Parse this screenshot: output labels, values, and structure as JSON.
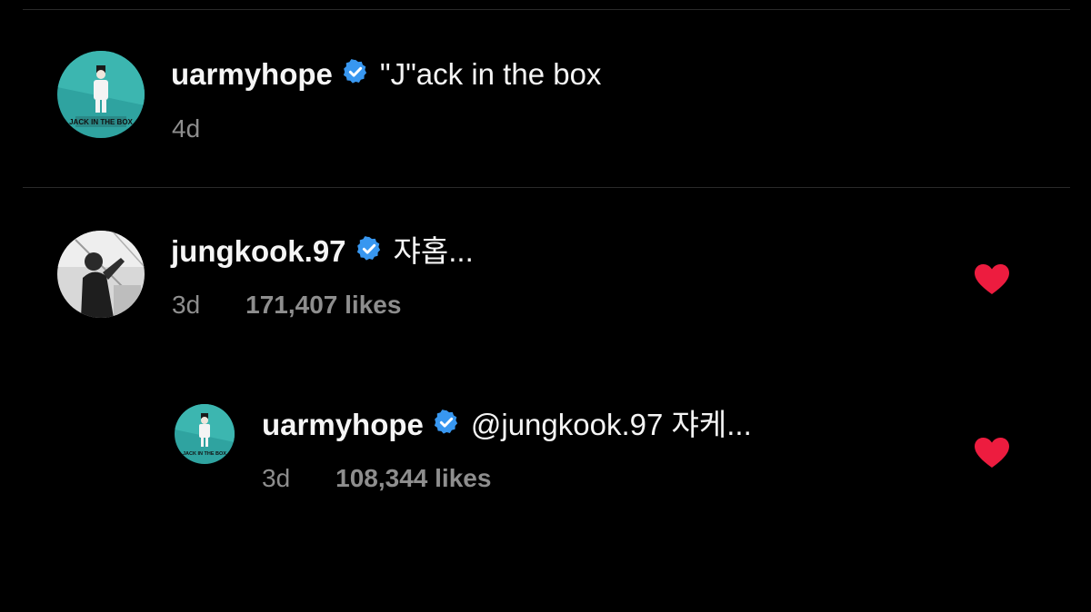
{
  "caption": {
    "username": "uarmyhope",
    "text": "\"J\"ack in the box",
    "time": "4d",
    "avatar_text": "JACK IN THE BOX"
  },
  "comments": [
    {
      "username": "jungkook.97",
      "text": "쟈홉...",
      "time": "3d",
      "likes": "171,407 likes",
      "liked": true
    },
    {
      "username": "uarmyhope",
      "text": "@jungkook.97 쟈케...",
      "time": "3d",
      "likes": "108,344 likes",
      "liked": true,
      "avatar_text": "JACK IN THE BOX"
    }
  ],
  "colors": {
    "background": "#000000",
    "verified": "#3897f0",
    "heart": "#ed1c3f",
    "meta": "#8e8e8e",
    "avatar_teal": "#2fa3a0"
  }
}
